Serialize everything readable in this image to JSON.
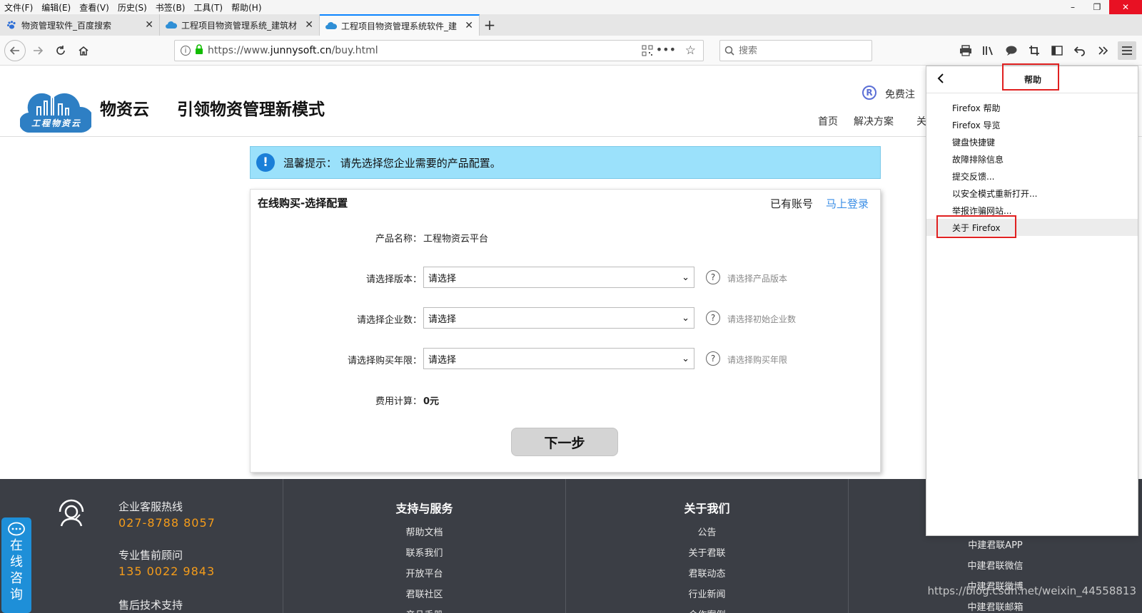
{
  "menubar": {
    "items": [
      "文件(F)",
      "编辑(E)",
      "查看(V)",
      "历史(S)",
      "书签(B)",
      "工具(T)",
      "帮助(H)"
    ],
    "window_controls": [
      "–",
      "❐",
      "✕"
    ]
  },
  "tabs": [
    {
      "label": "物资管理软件_百度搜索",
      "active": false,
      "favicon": "paw-icon"
    },
    {
      "label": "工程项目物资管理系统_建筑材",
      "active": false,
      "favicon": "cloud-icon"
    },
    {
      "label": "工程项目物资管理系统软件_建",
      "active": true,
      "favicon": "cloud-icon"
    }
  ],
  "new_tab_label": "+",
  "navbar": {
    "url_prefix": "https://www.",
    "url_domain": "junnysoft.cn",
    "url_path": "/buy.html",
    "search_placeholder": "搜索"
  },
  "site": {
    "logo_text": "工程物资云",
    "brand": "物资云",
    "slogan": "引领物资管理新模式",
    "register_text": "免费注",
    "nav": [
      "首页",
      "解决方案",
      "关"
    ]
  },
  "notice": {
    "icon": "!",
    "text": "温馨提示： 请先选择您企业需要的产品配置。"
  },
  "card": {
    "title": "在线购买-选择配置",
    "have_account": "已有账号",
    "login_link": "马上登录",
    "product_label": "产品名称：",
    "product_value": "工程物资云平台",
    "fields": [
      {
        "label": "请选择版本：",
        "value": "请选择",
        "hint": "请选择产品版本"
      },
      {
        "label": "请选择企业数：",
        "value": "请选择",
        "hint": "请选择初始企业数"
      },
      {
        "label": "请选择购买年限：",
        "value": "请选择",
        "hint": "请选择购买年限"
      }
    ],
    "cost_label": "费用计算：",
    "cost_value": "0元",
    "next_button": "下一步"
  },
  "footer": {
    "hotline_label": "企业客服热线",
    "hotline_number": "027-8788 8057",
    "presale_label": "专业售前顾问",
    "presale_number": "135 0022 9843",
    "aftersale_label": "售后技术支持",
    "support": {
      "title": "支持与服务",
      "links": [
        "帮助文档",
        "联系我们",
        "开放平台",
        "君联社区",
        "产品手册"
      ]
    },
    "about": {
      "title": "关于我们",
      "links": [
        "公告",
        "关于君联",
        "君联动态",
        "行业新闻",
        "合作案例"
      ]
    },
    "follow": {
      "links": [
        "中建君联APP",
        "中建君联微信",
        "中建君联微博",
        "中建君联邮箱"
      ]
    },
    "consult_chars": [
      "在",
      "线",
      "咨",
      "询"
    ]
  },
  "help_panel": {
    "title": "帮助",
    "items": [
      "Firefox 帮助",
      "Firefox 导览",
      "键盘快捷键",
      "故障排除信息",
      "提交反馈...",
      "以安全模式重新打开...",
      "举报诈骗网站...",
      "关于 Firefox"
    ]
  },
  "watermark": "https://blog.csdn.net/weixin_44558813"
}
